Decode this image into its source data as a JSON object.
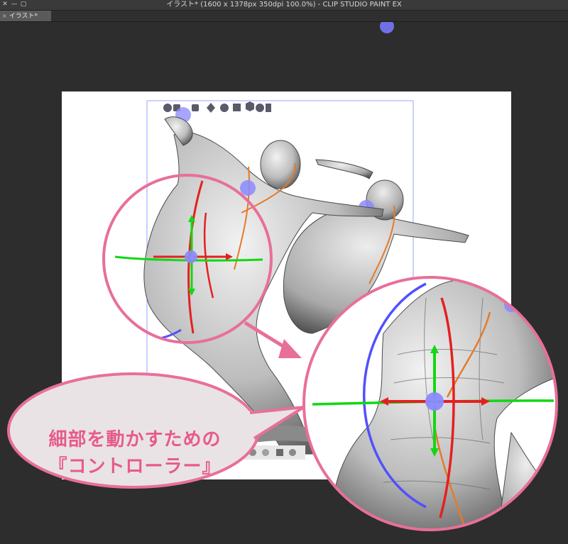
{
  "window": {
    "title": "イラスト* (1600 x 1378px 350dpi 100.0%)  - CLIP STUDIO PAINT EX",
    "controls": [
      "✕",
      "—",
      "▢"
    ]
  },
  "tabs": [
    {
      "label": "イラスト*",
      "close": "×"
    }
  ],
  "callout": {
    "line1": "細部を動かすための",
    "line2": "『コントローラー』"
  },
  "colors": {
    "accent_pink": "#e86f9a",
    "callout_text": "#e85a8a",
    "callout_fill": "#e9e3e6",
    "rotate_blue": "#5050ff",
    "axis_green": "#12d812",
    "axis_red": "#e42020",
    "joint_dot": "#8a8aff"
  },
  "model_toolbar_icons": [
    "move-camera-icon",
    "pan-icon",
    "zoom-icon",
    "model-move-icon",
    "rotate-icon",
    "align-icon",
    "cube-icon",
    "pose-icon",
    "reset-icon"
  ],
  "bottom_toolbar_icons": [
    "gear-icon",
    "light-icon",
    "settings-icon",
    "anchor-icon"
  ]
}
